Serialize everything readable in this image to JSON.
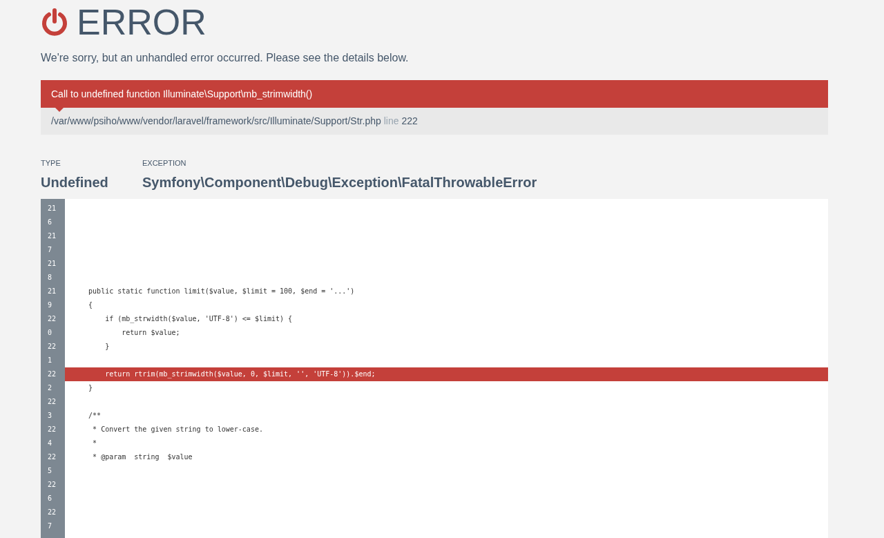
{
  "heading": "ERROR",
  "intro": "We're sorry, but an unhandled error occurred. Please see the details below.",
  "error": {
    "message": "Call to undefined function Illuminate\\Support\\mb_strimwidth()",
    "file": "/var/www/psiho/www/vendor/laravel/framework/src/Illuminate/Support/Str.php",
    "line_label": "line",
    "line": "222"
  },
  "details": [
    {
      "label": "TYPE",
      "value": "Undefined"
    },
    {
      "label": "EXCEPTION",
      "value": "Symfony\\Component\\Debug\\Exception\\FatalThrowableError"
    }
  ],
  "line_numbers": [
    "216",
    "217",
    "218",
    "219",
    "220",
    "221",
    "222",
    "223",
    "224",
    "225",
    "226",
    "227"
  ],
  "code": [
    {
      "kind": "blank"
    },
    {
      "kind": "blank"
    },
    {
      "kind": "blank"
    },
    {
      "kind": "blank"
    },
    {
      "kind": "blank"
    },
    {
      "kind": "blank"
    },
    {
      "kind": "code",
      "text": "    public static function limit($value, $limit = 100, $end = '...')",
      "highlighted": false
    },
    {
      "kind": "code",
      "text": "    {",
      "highlighted": false
    },
    {
      "kind": "code",
      "text": "        if (mb_strwidth($value, 'UTF-8') <= $limit) {",
      "highlighted": false
    },
    {
      "kind": "code",
      "text": "            return $value;",
      "highlighted": false
    },
    {
      "kind": "code",
      "text": "        }",
      "highlighted": false
    },
    {
      "kind": "blank"
    },
    {
      "kind": "code",
      "text": "        return rtrim(mb_strimwidth($value, 0, $limit, '', 'UTF-8')).$end;",
      "highlighted": true
    },
    {
      "kind": "code",
      "text": "    }",
      "highlighted": false
    },
    {
      "kind": "blank"
    },
    {
      "kind": "code",
      "text": "    /**",
      "highlighted": false
    },
    {
      "kind": "code",
      "text": "     * Convert the given string to lower-case.",
      "highlighted": false
    },
    {
      "kind": "code",
      "text": "     *",
      "highlighted": false
    },
    {
      "kind": "code",
      "text": "     * @param  string  $value",
      "highlighted": false
    }
  ]
}
